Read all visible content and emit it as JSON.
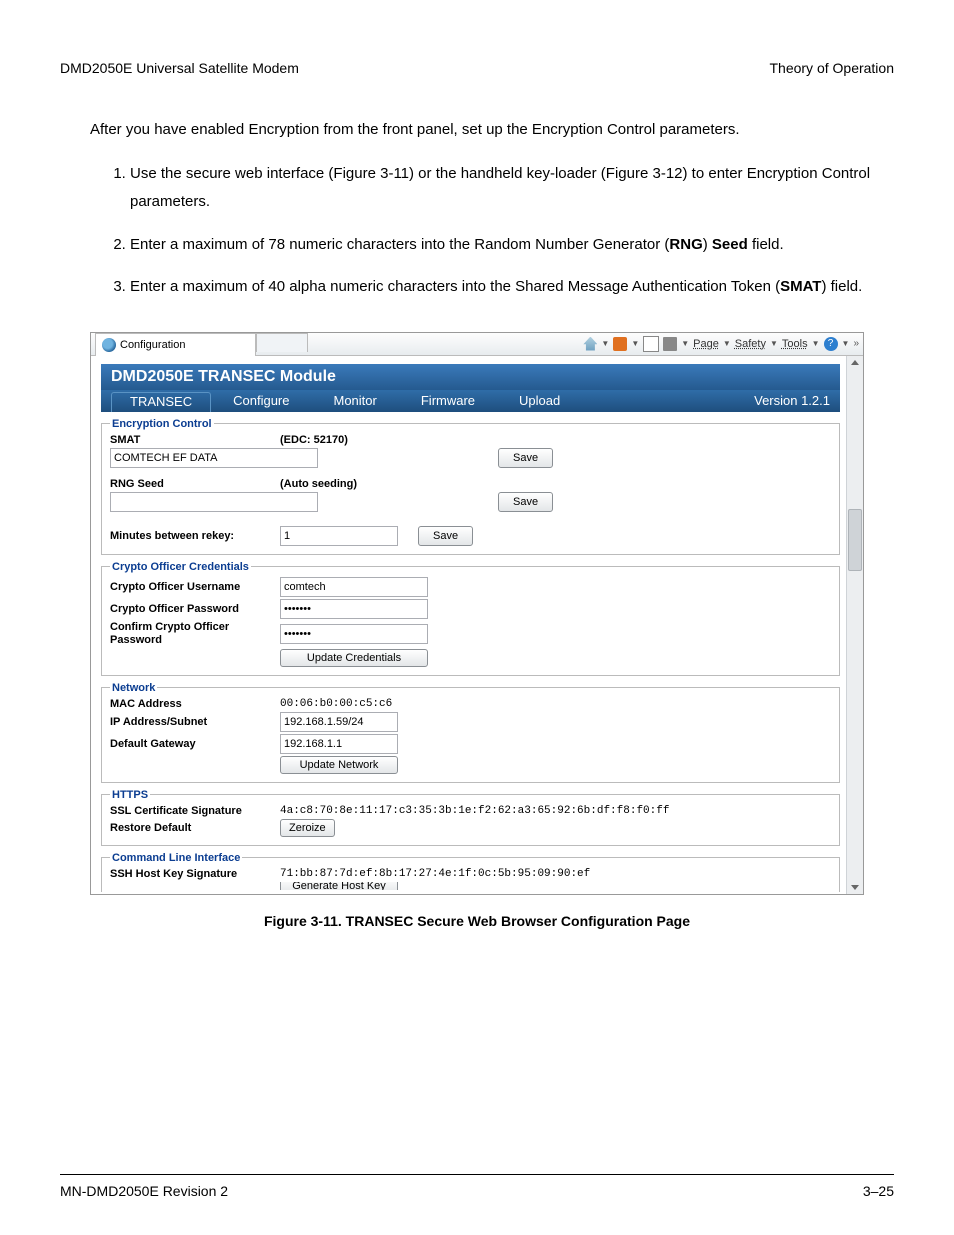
{
  "header": {
    "left": "DMD2050E Universal Satellite Modem",
    "right": "Theory of Operation"
  },
  "intro": "After you have enabled Encryption from the front panel, set up the Encryption Control parameters.",
  "steps": {
    "s1": "Use the secure web interface (Figure 3-11) or the handheld key-loader (Figure 3-12) to enter Encryption Control parameters.",
    "s2a": "Enter a maximum of 78 numeric characters into the Random Number Generator (",
    "s2b": "RNG",
    "s2c": ") ",
    "s2d": "Seed",
    "s2e": " field.",
    "s3a": "Enter a maximum of 40 alpha numeric characters into the Shared Message Authentication Token (",
    "s3b": "SMAT",
    "s3c": ") field."
  },
  "ie": {
    "tab_title": "Configuration",
    "menu_page": "Page",
    "menu_safety": "Safety",
    "menu_tools": "Tools"
  },
  "mod": {
    "banner": "DMD2050E TRANSEC Module",
    "nav_transec": "TRANSEC",
    "nav_configure": "Configure",
    "nav_monitor": "Monitor",
    "nav_firmware": "Firmware",
    "nav_upload": "Upload",
    "version": "Version 1.2.1"
  },
  "enc": {
    "legend": "Encryption Control",
    "smat_label": "SMAT",
    "smat_hint": "(EDC: 52170)",
    "smat_value": "COMTECH EF DATA",
    "smat_save": "Save",
    "rng_label": "RNG Seed",
    "rng_hint": "(Auto seeding)",
    "rng_value": "",
    "rng_save": "Save",
    "rekey_label": "Minutes between rekey:",
    "rekey_value": "1",
    "rekey_save": "Save"
  },
  "cred": {
    "legend": "Crypto Officer Credentials",
    "user_label": "Crypto Officer Username",
    "user_value": "comtech",
    "pass_label": "Crypto Officer Password",
    "pass_value": "•••••••",
    "conf_label": "Confirm Crypto Officer Password",
    "conf_value": "•••••••",
    "update": "Update Credentials"
  },
  "net": {
    "legend": "Network",
    "mac_label": "MAC Address",
    "mac_value": "00:06:b0:00:c5:c6",
    "ip_label": "IP Address/Subnet",
    "ip_value": "192.168.1.59/24",
    "gw_label": "Default Gateway",
    "gw_value": "192.168.1.1",
    "update": "Update Network"
  },
  "https": {
    "legend": "HTTPS",
    "sig_label": "SSL Certificate Signature",
    "sig_value": "4a:c8:70:8e:11:17:c3:35:3b:1e:f2:62:a3:65:92:6b:df:f8:f0:ff",
    "restore_label": "Restore Default",
    "zeroize": "Zeroize"
  },
  "cli": {
    "legend": "Command Line Interface",
    "ssh_label": "SSH Host Key Signature",
    "ssh_value": "71:bb:87:7d:ef:8b:17:27:4e:1f:0c:5b:95:09:90:ef",
    "gen": "Generate Host Key"
  },
  "caption": "Figure 3-11. TRANSEC Secure Web Browser Configuration Page",
  "footer": {
    "left": "MN-DMD2050E   Revision 2",
    "right": "3–25"
  }
}
